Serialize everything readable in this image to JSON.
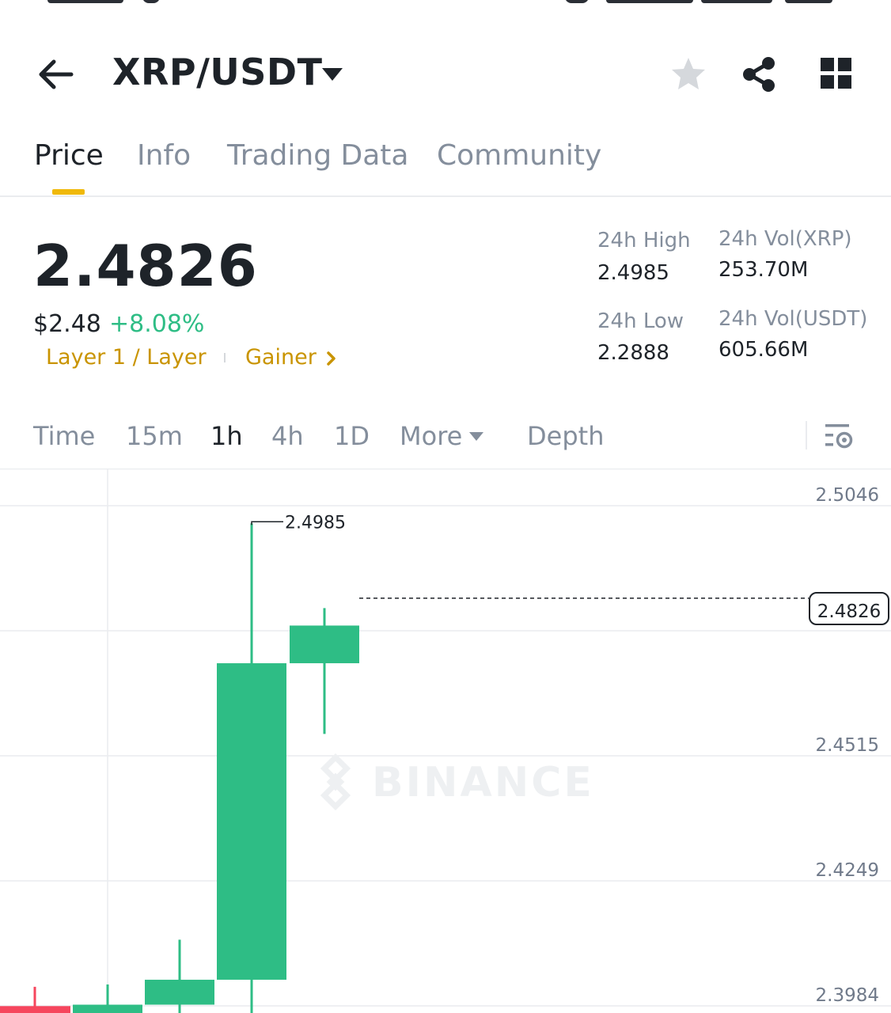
{
  "header": {
    "pair": "XRP/USDT",
    "icons": [
      "back-arrow-icon",
      "caret-down-icon",
      "star-icon",
      "share-icon",
      "grid-icon"
    ]
  },
  "tabs": [
    {
      "label": "Price",
      "active": true
    },
    {
      "label": "Info",
      "active": false
    },
    {
      "label": "Trading Data",
      "active": false
    },
    {
      "label": "Community",
      "active": false
    }
  ],
  "price": {
    "last": "2.4826",
    "usd": "$2.48",
    "change": "+8.08%",
    "tags": [
      "Layer 1 / Layer",
      "Gainer"
    ]
  },
  "stats": {
    "high_label": "24h High",
    "high_value": "2.4985",
    "low_label": "24h Low",
    "low_value": "2.2888",
    "vol_base_label": "24h Vol(XRP)",
    "vol_base_value": "253.70M",
    "vol_quote_label": "24h Vol(USDT)",
    "vol_quote_value": "605.66M"
  },
  "intervals": [
    {
      "label": "Time",
      "active": false
    },
    {
      "label": "15m",
      "active": false
    },
    {
      "label": "1h",
      "active": true
    },
    {
      "label": "4h",
      "active": false
    },
    {
      "label": "1D",
      "active": false
    },
    {
      "label": "More",
      "active": false
    },
    {
      "label": "Depth",
      "active": false
    }
  ],
  "colors": {
    "up": "#2ebd85",
    "down": "#f6465d",
    "accent": "#f0b90b",
    "tag": "#c99400",
    "muted": "#848e9c"
  },
  "chart_data": {
    "type": "candlestick",
    "interval": "1h",
    "price_axis_ticks": [
      "2.5046",
      "2.4515",
      "2.4249",
      "2.3984"
    ],
    "current_price": "2.4826",
    "high_marker": "2.4985",
    "watermark": "BINANCE",
    "candles": [
      {
        "open": 2.396,
        "close": 2.391,
        "high": 2.4001,
        "low": 2.39,
        "direction": "down"
      },
      {
        "open": 2.391,
        "close": 2.3963,
        "high": 2.4006,
        "low": 2.39,
        "direction": "up"
      },
      {
        "open": 2.3963,
        "close": 2.4016,
        "high": 2.4101,
        "low": 2.39,
        "direction": "up"
      },
      {
        "open": 2.4016,
        "close": 2.4688,
        "high": 2.4985,
        "low": 2.3918,
        "direction": "up"
      },
      {
        "open": 2.4688,
        "close": 2.4768,
        "high": 2.4805,
        "low": 2.4538,
        "direction": "up"
      }
    ]
  }
}
